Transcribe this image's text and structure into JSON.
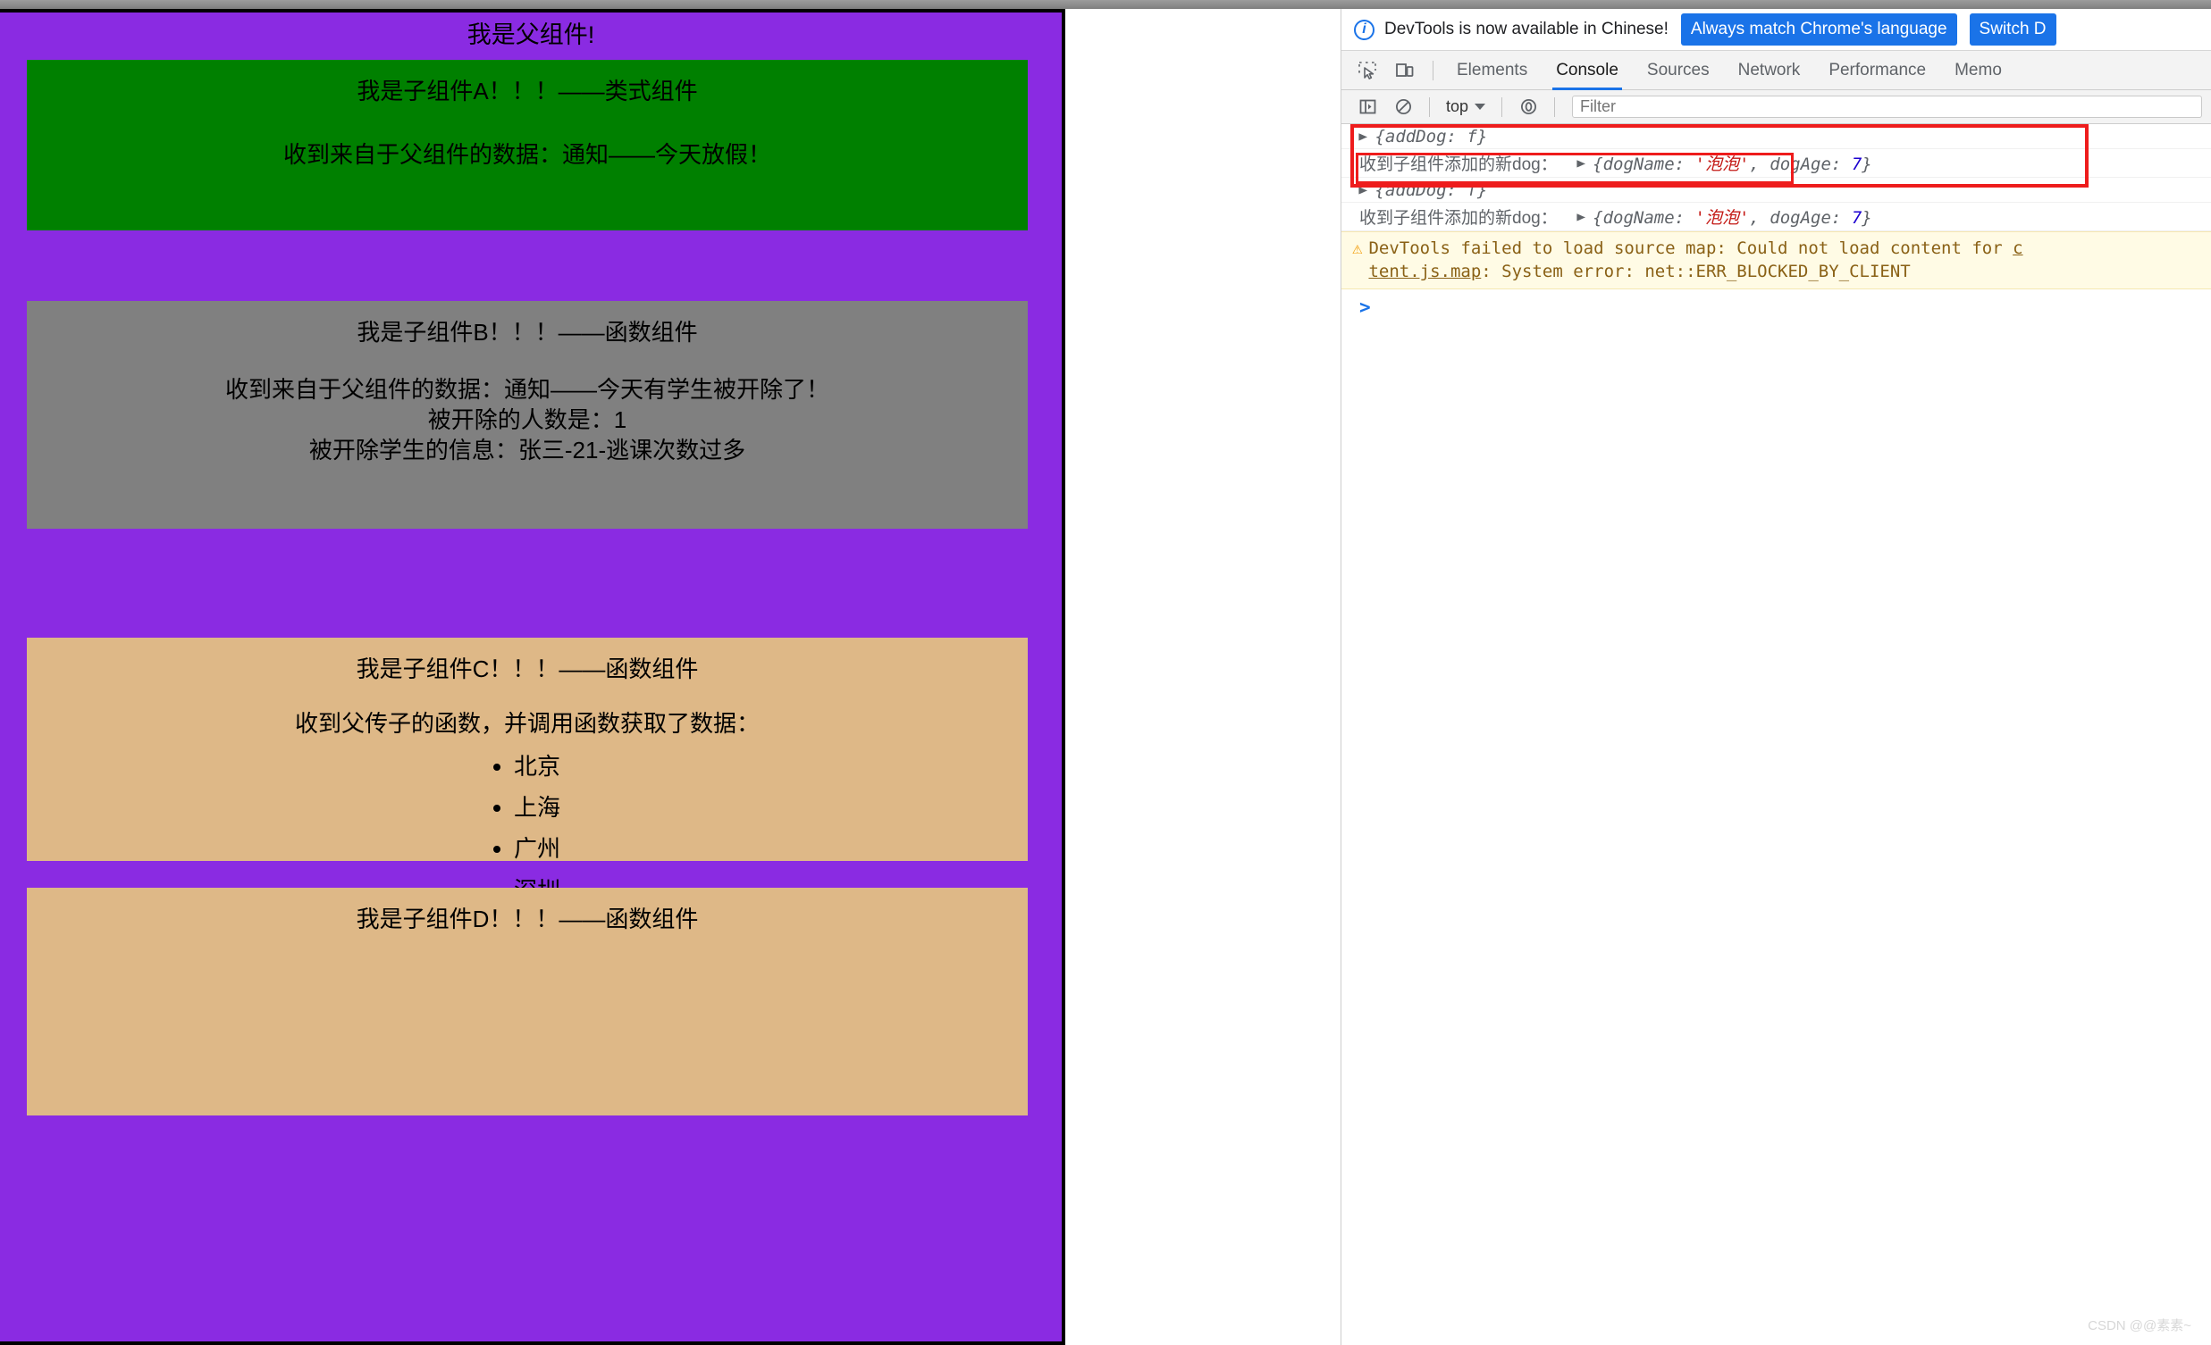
{
  "page": {
    "parent_title": "我是父组件!",
    "children": [
      {
        "id": "A",
        "title": "我是子组件A！！！——类式组件",
        "lines": [
          "收到来自于父组件的数据：通知——今天放假！"
        ],
        "bg": "#008000"
      },
      {
        "id": "B",
        "title": "我是子组件B！！！——函数组件",
        "lines": [
          "收到来自于父组件的数据：通知——今天有学生被开除了！",
          "被开除的人数是：1",
          "被开除学生的信息：张三-21-逃课次数过多"
        ],
        "bg": "#808080"
      },
      {
        "id": "C",
        "title": "我是子组件C！！！——函数组件",
        "lines": [
          "收到父传子的函数，并调用函数获取了数据："
        ],
        "cities": [
          "北京",
          "上海",
          "广州",
          "深圳"
        ],
        "bg": "#DEB887"
      },
      {
        "id": "D",
        "title": "我是子组件D！！！——函数组件",
        "lines": [],
        "bg": "#DEB887"
      }
    ],
    "parent_bg": "#8A2BE2"
  },
  "devtools": {
    "notice": {
      "icon": "info-icon",
      "message": "DevTools is now available in Chinese!",
      "primary_button": "Always match Chrome's language",
      "secondary_button": "Switch D"
    },
    "toolbar_icons": [
      "inspect-element-icon",
      "device-toolbar-icon"
    ],
    "tabs": [
      {
        "label": "Elements",
        "active": false
      },
      {
        "label": "Console",
        "active": true
      },
      {
        "label": "Sources",
        "active": false
      },
      {
        "label": "Network",
        "active": false
      },
      {
        "label": "Performance",
        "active": false
      },
      {
        "label": "Memo",
        "active": false
      }
    ],
    "console_toolbar": {
      "sidebar_icon": "console-sidebar-icon",
      "clear_icon": "clear-console-icon",
      "context": "top",
      "eye_icon": "live-expression-icon",
      "filter_placeholder": "Filter"
    },
    "logs": [
      {
        "type": "object",
        "triangle": "▶",
        "text": "{addDog: f}",
        "dimmed": false
      },
      {
        "type": "labeled-object",
        "label": "收到子组件添加的新dog：",
        "triangle": "▶",
        "obj_open": "{dogName: ",
        "obj_string": "'泡泡'",
        "obj_mid": ", dogAge: ",
        "obj_number": "7",
        "obj_close": "}",
        "dimmed": false
      },
      {
        "type": "object",
        "triangle": "▶",
        "text": "{addDog: f}",
        "dimmed": true
      },
      {
        "type": "labeled-object",
        "label": "收到子组件添加的新dog：",
        "triangle": "▶",
        "obj_open": "{dogName: ",
        "obj_string": "'泡泡'",
        "obj_mid": ", dogAge: ",
        "obj_number": "7",
        "obj_close": "}",
        "dimmed": true
      }
    ],
    "warning": {
      "icon": "warning-triangle-icon",
      "line1_plain": "DevTools failed to load source map: Could not load content for ",
      "line1_link": "c",
      "line2_link": "tent.js.map",
      "line2_plain": ": System error: net::ERR_BLOCKED_BY_CLIENT"
    },
    "prompt": ">",
    "annotation_color": "#ee1c1c"
  },
  "watermark": "CSDN @@素素~"
}
